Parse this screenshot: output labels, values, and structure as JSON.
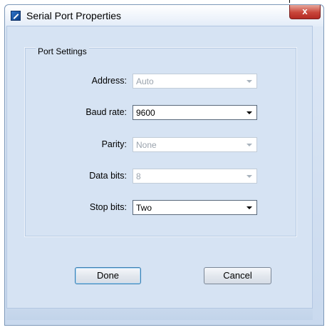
{
  "window": {
    "title": "Serial Port Properties",
    "close_glyph": "x"
  },
  "group": {
    "title": "Port Settings"
  },
  "fields": [
    {
      "label": "Address:",
      "value": "Auto",
      "enabled": false
    },
    {
      "label": "Baud rate:",
      "value": "9600",
      "enabled": true
    },
    {
      "label": "Parity:",
      "value": "None",
      "enabled": false
    },
    {
      "label": "Data bits:",
      "value": "8",
      "enabled": false
    },
    {
      "label": "Stop bits:",
      "value": "Two",
      "enabled": true
    }
  ],
  "buttons": {
    "done": "Done",
    "cancel": "Cancel"
  },
  "icons": {
    "app": "app-icon",
    "close": "close-icon",
    "dropdown": "chevron-down-icon"
  }
}
